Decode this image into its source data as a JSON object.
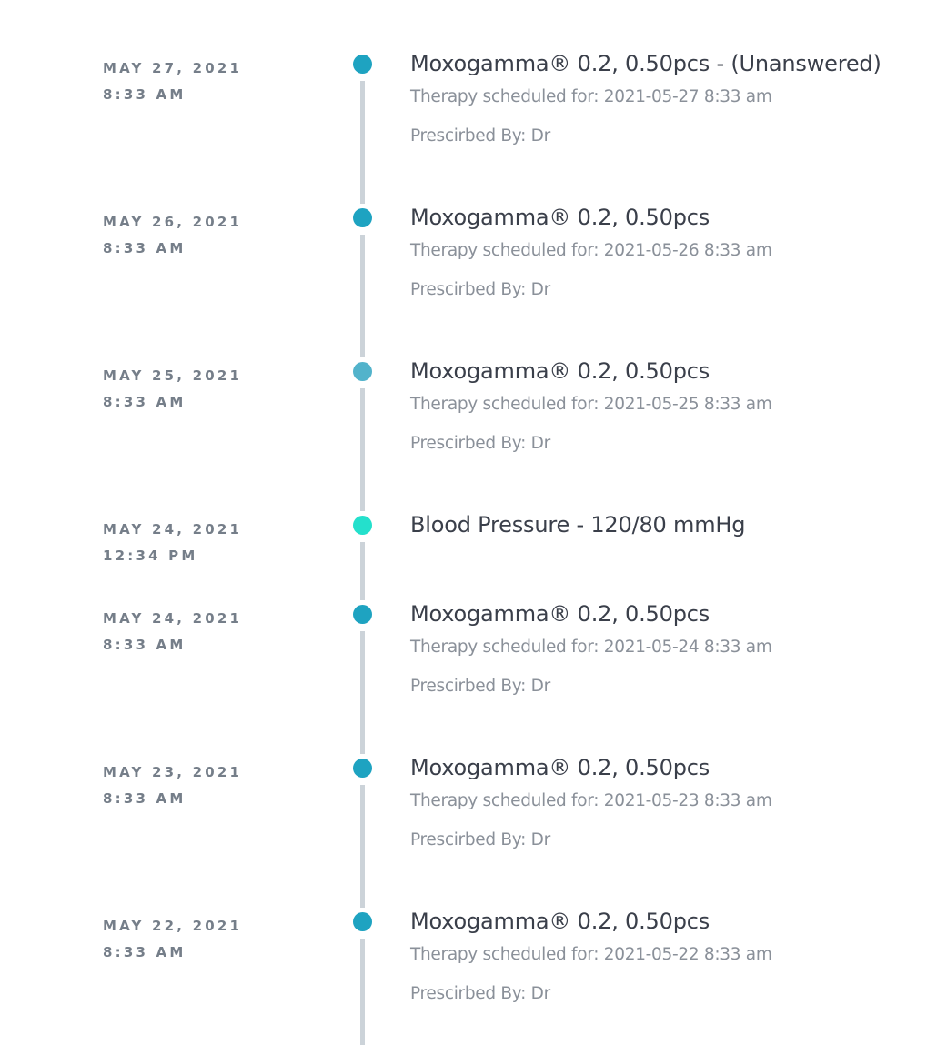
{
  "colors": {
    "dot_primary": "#1ea3c1",
    "dot_faded": "#52b3cb",
    "dot_vitals": "#24e0cc",
    "line": "#ccd3d9",
    "date_text": "#757e89",
    "title_text": "#3a3f4a",
    "sub_text": "#8a9099"
  },
  "timeline": [
    {
      "date": "MAY 27, 2021",
      "time": "8:33 AM",
      "title": "Moxogamma® 0.2, 0.50pcs - (Unanswered)",
      "scheduled": "Therapy scheduled for: 2021-05-27 8:33 am",
      "prescribed": "Prescirbed By: Dr",
      "dot": "primary"
    },
    {
      "date": "MAY 26, 2021",
      "time": "8:33 AM",
      "title": "Moxogamma® 0.2, 0.50pcs",
      "scheduled": "Therapy scheduled for: 2021-05-26 8:33 am",
      "prescribed": "Prescirbed By: Dr",
      "dot": "primary"
    },
    {
      "date": "MAY 25, 2021",
      "time": "8:33 AM",
      "title": "Moxogamma® 0.2, 0.50pcs",
      "scheduled": "Therapy scheduled for: 2021-05-25 8:33 am",
      "prescribed": "Prescirbed By: Dr",
      "dot": "faded"
    },
    {
      "date": "MAY 24, 2021",
      "time": "12:34 PM",
      "title": "Blood Pressure - 120/80 mmHg",
      "dot": "vitals"
    },
    {
      "date": "MAY 24, 2021",
      "time": "8:33 AM",
      "title": "Moxogamma® 0.2, 0.50pcs",
      "scheduled": "Therapy scheduled for: 2021-05-24 8:33 am",
      "prescribed": "Prescirbed By: Dr",
      "dot": "primary"
    },
    {
      "date": "MAY 23, 2021",
      "time": "8:33 AM",
      "title": "Moxogamma® 0.2, 0.50pcs",
      "scheduled": "Therapy scheduled for: 2021-05-23 8:33 am",
      "prescribed": "Prescirbed By: Dr",
      "dot": "primary"
    },
    {
      "date": "MAY 22, 2021",
      "time": "8:33 AM",
      "title": "Moxogamma® 0.2, 0.50pcs",
      "scheduled": "Therapy scheduled for: 2021-05-22 8:33 am",
      "prescribed": "Prescirbed By: Dr",
      "dot": "primary"
    }
  ]
}
